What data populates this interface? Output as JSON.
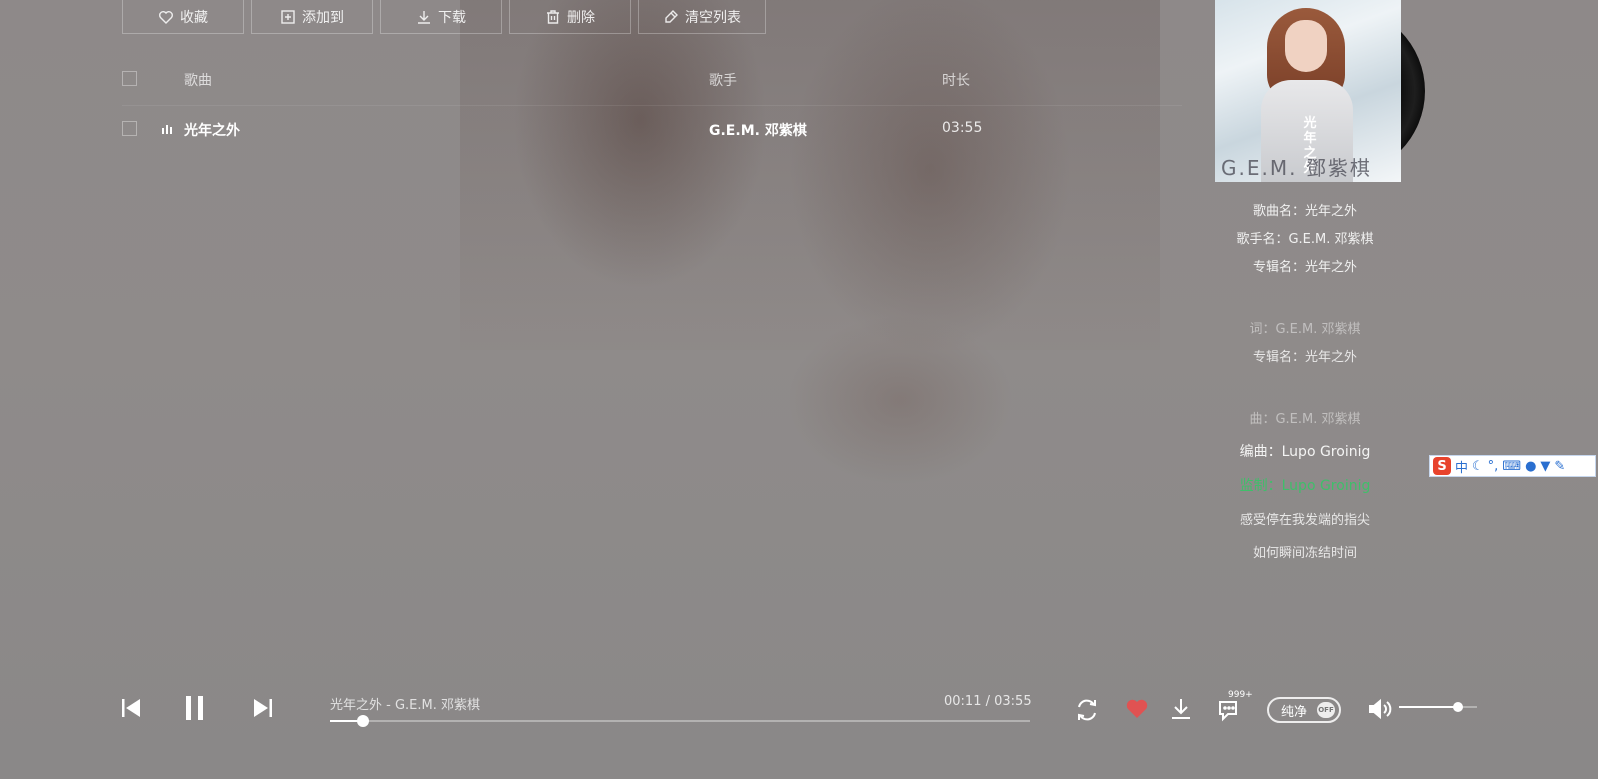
{
  "toolbar": {
    "favorite": "收藏",
    "add_to": "添加到",
    "download": "下载",
    "delete": "删除",
    "clear_list": "清空列表"
  },
  "list": {
    "headers": {
      "song": "歌曲",
      "singer": "歌手",
      "duration": "时长"
    },
    "rows": [
      {
        "song": "光年之外",
        "singer": "G.E.M. 邓紫棋",
        "duration": "03:55"
      }
    ]
  },
  "album": {
    "cover_title": "光年之外",
    "cover_artist": "G.E.M. 鄧紫棋"
  },
  "info": {
    "song_name": "歌曲名：光年之外",
    "singer_name": "歌手名：G.E.M. 邓紫棋",
    "album_name": "专辑名：光年之外"
  },
  "lyrics": [
    "词：G.E.M. 邓紫棋",
    "专辑名：光年之外",
    "曲：G.E.M. 邓紫棋",
    "编曲：Lupo Groinig",
    "监制：Lupo Groinig",
    "感受停在我发端的指尖",
    "如何瞬间冻结时间"
  ],
  "ime": {
    "logo": "S",
    "mode": "中",
    "punct": "°,"
  },
  "player": {
    "now_playing": "光年之外 - G.E.M. 邓紫棋",
    "current": "00:11",
    "separator": " / ",
    "total": "03:55",
    "progress_fraction": 0.047,
    "comment_count": "999+",
    "pure_label": "纯净",
    "pure_state": "OFF",
    "volume_fraction": 0.75,
    "favorite_color": "#e05252",
    "active_lyric_color": "#3fbf6a"
  }
}
